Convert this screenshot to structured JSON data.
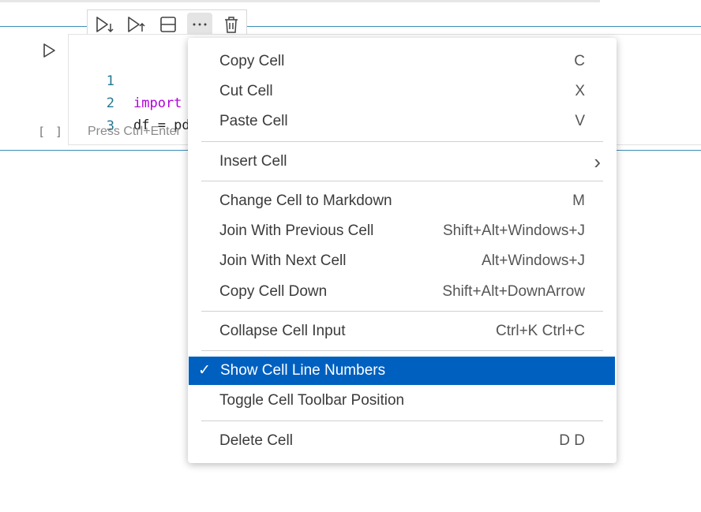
{
  "toolbar": {
    "buttons": [
      {
        "icon": "run-below-icon"
      },
      {
        "icon": "run-above-icon"
      },
      {
        "icon": "split-cell-icon"
      },
      {
        "icon": "more-actions-icon"
      },
      {
        "icon": "trash-icon"
      }
    ]
  },
  "cell": {
    "execution_count": "[ ]",
    "lines": [
      {
        "num": "1",
        "keyword": "import",
        "text": ""
      },
      {
        "num": "2",
        "keyword": "",
        "text": "df = pd"
      },
      {
        "num": "3",
        "keyword": "",
        "text": ""
      }
    ],
    "hint": "Press Ctrl+Enter"
  },
  "menu": {
    "items": [
      {
        "label": "Copy Cell",
        "shortcut": "C"
      },
      {
        "label": "Cut Cell",
        "shortcut": "X"
      },
      {
        "label": "Paste Cell",
        "shortcut": "V"
      },
      {
        "label": "Insert Cell",
        "shortcut": ""
      },
      {
        "label": "Change Cell to Markdown",
        "shortcut": "M"
      },
      {
        "label": "Join With Previous Cell",
        "shortcut": "Shift+Alt+Windows+J"
      },
      {
        "label": "Join With Next Cell",
        "shortcut": "Alt+Windows+J"
      },
      {
        "label": "Copy Cell Down",
        "shortcut": "Shift+Alt+DownArrow"
      },
      {
        "label": "Collapse Cell Input",
        "shortcut": "Ctrl+K Ctrl+C"
      },
      {
        "label": "Show Cell Line Numbers",
        "shortcut": "",
        "checked": "✓"
      },
      {
        "label": "Toggle Cell Toolbar Position",
        "shortcut": ""
      },
      {
        "label": "Delete Cell",
        "shortcut": "D D"
      }
    ],
    "submenu_arrow": "›"
  },
  "colors": {
    "accent": "#0060c0",
    "cell_border": "#3a8fb7",
    "keyword": "#af00db",
    "line_number": "#237893"
  }
}
